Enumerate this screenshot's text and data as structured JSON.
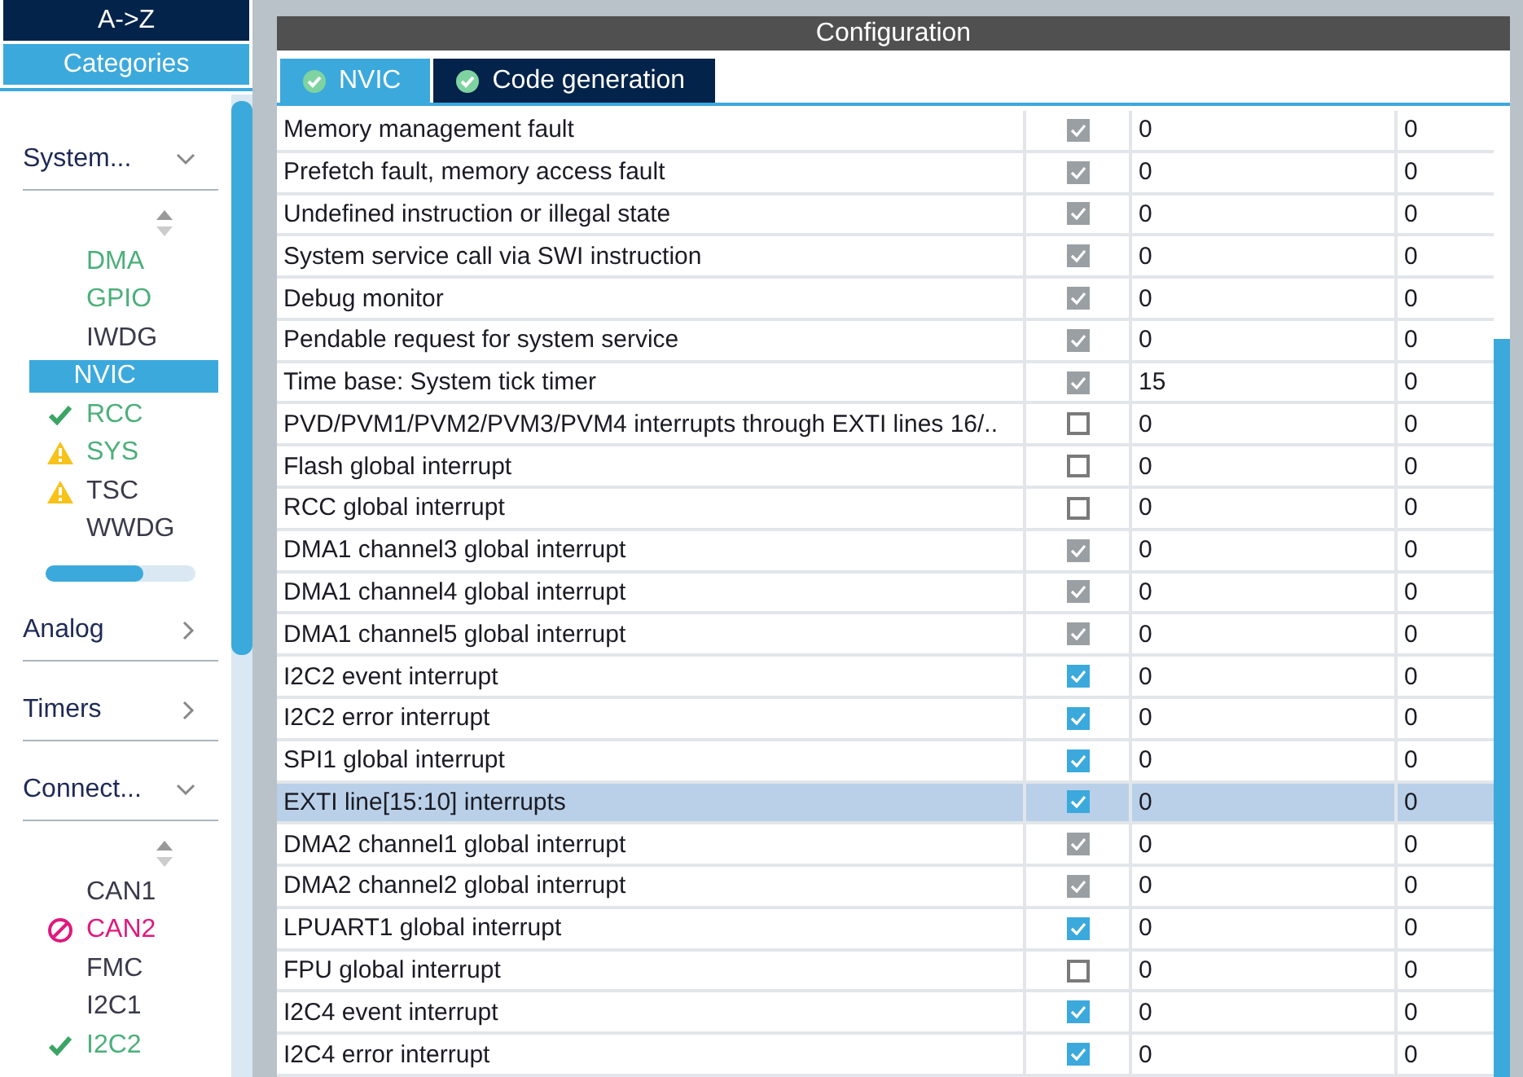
{
  "sidebar": {
    "sort_button": "A->Z",
    "categories_button": "Categories",
    "groups": [
      {
        "label": "System...",
        "expanded": true,
        "items": [
          {
            "label": "DMA",
            "kind": "plain",
            "color": "#4caf7a",
            "selected": false
          },
          {
            "label": "GPIO",
            "kind": "plain",
            "color": "#4caf7a",
            "selected": false
          },
          {
            "label": "IWDG",
            "kind": "plain",
            "color": "#3a3a4a",
            "selected": false
          },
          {
            "label": "NVIC",
            "kind": "plain",
            "selected": true
          },
          {
            "label": "RCC",
            "kind": "ok",
            "color": "#4caf7a",
            "selected": false
          },
          {
            "label": "SYS",
            "kind": "warning",
            "color": "#4caf7a",
            "selected": false
          },
          {
            "label": "TSC",
            "kind": "warning",
            "color": "#3a3a4a",
            "selected": false
          },
          {
            "label": "WWDG",
            "kind": "plain",
            "color": "#3a3a4a",
            "selected": false
          }
        ],
        "hscroll": {
          "level": 0.65
        }
      },
      {
        "label": "Analog",
        "expanded": false
      },
      {
        "label": "Timers",
        "expanded": false
      },
      {
        "label": "Connect...",
        "expanded": true,
        "items": [
          {
            "label": "CAN1",
            "kind": "plain",
            "color": "#3a3a4a",
            "selected": false
          },
          {
            "label": "CAN2",
            "kind": "blocked",
            "color": "#e0197d",
            "selected": false
          },
          {
            "label": "FMC",
            "kind": "plain",
            "color": "#3a3a4a",
            "selected": false
          },
          {
            "label": "I2C1",
            "kind": "plain",
            "color": "#3a3a4a",
            "selected": false
          },
          {
            "label": "I2C2",
            "kind": "ok",
            "color": "#4caf7a",
            "selected": false
          }
        ]
      }
    ]
  },
  "configuration": {
    "title": "Configuration",
    "tabs": [
      {
        "label": "NVIC",
        "selected": true
      },
      {
        "label": "Code generation",
        "selected": false
      }
    ],
    "rows": [
      {
        "name": "Memory management fault",
        "checked": true,
        "disabled": true,
        "col_3": "0",
        "col_4": "0",
        "selected": false
      },
      {
        "name": "Prefetch fault, memory access fault",
        "checked": true,
        "disabled": true,
        "col_3": "0",
        "col_4": "0",
        "selected": false
      },
      {
        "name": "Undefined instruction or illegal state",
        "checked": true,
        "disabled": true,
        "col_3": "0",
        "col_4": "0",
        "selected": false
      },
      {
        "name": "System service call via SWI instruction",
        "checked": true,
        "disabled": true,
        "col_3": "0",
        "col_4": "0",
        "selected": false
      },
      {
        "name": "Debug monitor",
        "checked": true,
        "disabled": true,
        "col_3": "0",
        "col_4": "0",
        "selected": false
      },
      {
        "name": "Pendable request for system service",
        "checked": true,
        "disabled": true,
        "col_3": "0",
        "col_4": "0",
        "selected": false
      },
      {
        "name": "Time base: System tick timer",
        "checked": true,
        "disabled": true,
        "col_3": "15",
        "col_4": "0",
        "selected": false
      },
      {
        "name": "PVD/PVM1/PVM2/PVM3/PVM4 interrupts through EXTI lines 16/..",
        "checked": false,
        "disabled": false,
        "col_3": "0",
        "col_4": "0",
        "selected": false
      },
      {
        "name": "Flash global interrupt",
        "checked": false,
        "disabled": false,
        "col_3": "0",
        "col_4": "0",
        "selected": false
      },
      {
        "name": "RCC global interrupt",
        "checked": false,
        "disabled": false,
        "col_3": "0",
        "col_4": "0",
        "selected": false
      },
      {
        "name": "DMA1 channel3 global interrupt",
        "checked": true,
        "disabled": true,
        "col_3": "0",
        "col_4": "0",
        "selected": false
      },
      {
        "name": "DMA1 channel4 global interrupt",
        "checked": true,
        "disabled": true,
        "col_3": "0",
        "col_4": "0",
        "selected": false
      },
      {
        "name": "DMA1 channel5 global interrupt",
        "checked": true,
        "disabled": true,
        "col_3": "0",
        "col_4": "0",
        "selected": false
      },
      {
        "name": "I2C2 event interrupt",
        "checked": true,
        "disabled": false,
        "col_3": "0",
        "col_4": "0",
        "selected": false
      },
      {
        "name": "I2C2 error interrupt",
        "checked": true,
        "disabled": false,
        "col_3": "0",
        "col_4": "0",
        "selected": false
      },
      {
        "name": "SPI1 global interrupt",
        "checked": true,
        "disabled": false,
        "col_3": "0",
        "col_4": "0",
        "selected": false
      },
      {
        "name": "EXTI line[15:10] interrupts",
        "checked": true,
        "disabled": false,
        "col_3": "0",
        "col_4": "0",
        "selected": true
      },
      {
        "name": "DMA2 channel1 global interrupt",
        "checked": true,
        "disabled": true,
        "col_3": "0",
        "col_4": "0",
        "selected": false
      },
      {
        "name": "DMA2 channel2 global interrupt",
        "checked": true,
        "disabled": true,
        "col_3": "0",
        "col_4": "0",
        "selected": false
      },
      {
        "name": "LPUART1 global interrupt",
        "checked": true,
        "disabled": false,
        "col_3": "0",
        "col_4": "0",
        "selected": false
      },
      {
        "name": "FPU global interrupt",
        "checked": false,
        "disabled": false,
        "col_3": "0",
        "col_4": "0",
        "selected": false
      },
      {
        "name": "I2C4 event interrupt",
        "checked": true,
        "disabled": false,
        "col_3": "0",
        "col_4": "0",
        "selected": false
      },
      {
        "name": "I2C4 error interrupt",
        "checked": true,
        "disabled": false,
        "col_3": "0",
        "col_4": "0",
        "selected": false
      }
    ]
  }
}
